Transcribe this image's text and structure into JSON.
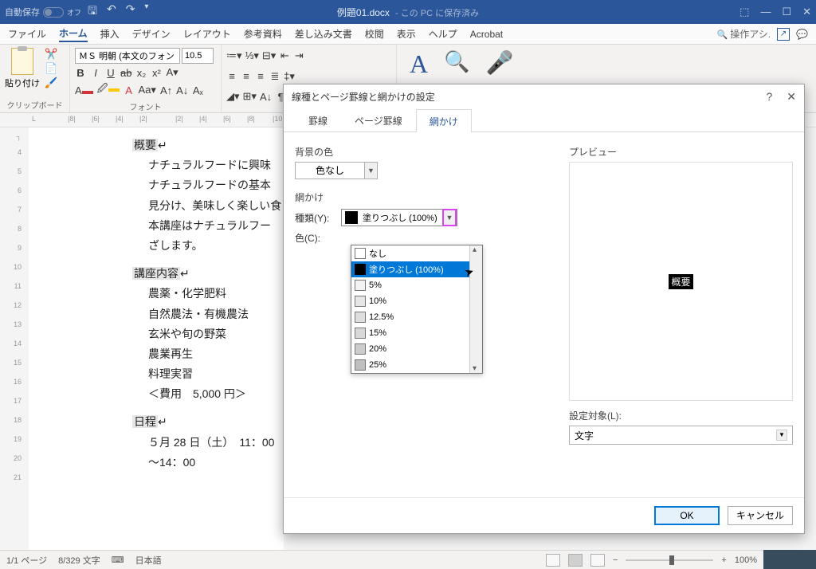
{
  "titlebar": {
    "autosave_label": "自動保存",
    "autosave_state": "オフ",
    "title_file": "例題01.docx",
    "title_sub": " - この PC に保存済み"
  },
  "ribbon_tabs": {
    "file": "ファイル",
    "home": "ホーム",
    "insert": "挿入",
    "design": "デザイン",
    "layout": "レイアウト",
    "references": "参考資料",
    "mail": "差し込み文書",
    "review": "校閲",
    "view": "表示",
    "help": "ヘルプ",
    "acrobat": "Acrobat",
    "tellme": "操作アシ."
  },
  "ribbon": {
    "paste_label": "貼り付け",
    "group_clipboard": "クリップボード",
    "font_name": "ＭＳ 明朝 (本文のフォント -",
    "font_size": "10.5",
    "group_font": "フォント"
  },
  "doc": {
    "h1": "概要",
    "p1": "ナチュラルフードに興味",
    "p2": "ナチュラルフードの基本",
    "p3": "見分け、美味しく楽しい食",
    "p4": "本講座はナチュラルフー",
    "p5": "ざします。",
    "h2": "講座内容",
    "l1": "農薬・化学肥料",
    "l2": "自然農法・有機農法",
    "l3": "玄米や旬の野菜",
    "l4": "農業再生",
    "l5": "料理実習",
    "l6": "＜費用　5,000 円＞",
    "h3": "日程",
    "d1": "５月 28 日（土）　11：00～14：00"
  },
  "dialog": {
    "title": "線種とページ罫線と網かけの設定",
    "tab1": "罫線",
    "tab2": "ページ罫線",
    "tab3": "網かけ",
    "bgcolor_label": "背景の色",
    "bgcolor_value": "色なし",
    "section_shade": "網かけ",
    "type_label": "種類(Y):",
    "type_value": "塗りつぶし (100%)",
    "color_label": "色(C):",
    "opts": {
      "none": "なし",
      "solid": "塗りつぶし (100%)",
      "p5": "5%",
      "p10": "10%",
      "p12": "12.5%",
      "p15": "15%",
      "p20": "20%",
      "p25": "25%"
    },
    "preview_label": "プレビュー",
    "preview_sample": "概要",
    "apply_label": "設定対象(L):",
    "apply_value": "文字",
    "btn_ok": "OK",
    "btn_cancel": "キャンセル"
  },
  "statusbar": {
    "page": "1/1 ページ",
    "words": "8/329 文字",
    "lang": "日本語",
    "zoom": "100%"
  }
}
